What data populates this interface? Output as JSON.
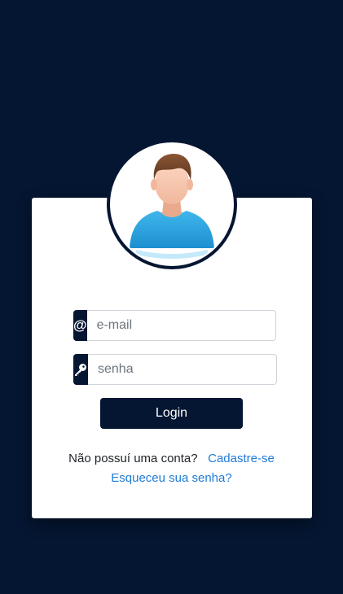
{
  "login_form": {
    "email_placeholder": "e-mail",
    "email_value": "",
    "password_placeholder": "senha",
    "password_value": "",
    "email_addon": "@",
    "submit_label": "Login"
  },
  "footer": {
    "no_account_text": "Não possuí uma conta?",
    "signup_link": "Cadastre-se",
    "forgot_link": "Esqueceu sua senha?"
  },
  "icons": {
    "email": "at-icon",
    "password": "key-icon",
    "avatar": "user-avatar-icon"
  },
  "colors": {
    "background": "#051632",
    "card": "#ffffff",
    "accent": "#051632",
    "link": "#1e7bd6"
  }
}
